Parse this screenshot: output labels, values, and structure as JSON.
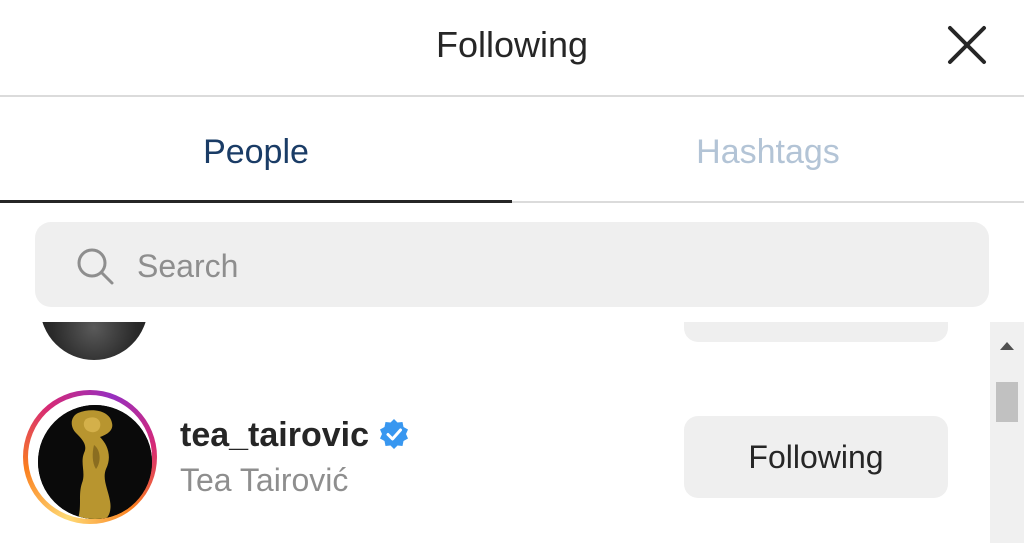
{
  "header": {
    "title": "Following",
    "close_icon": "close-icon"
  },
  "tabs": [
    {
      "label": "People",
      "active": true
    },
    {
      "label": "Hashtags",
      "active": false
    }
  ],
  "search": {
    "placeholder": "Search",
    "value": ""
  },
  "list": {
    "items": [
      {
        "username": "tea_tairovic",
        "full_name": "Tea Tairović",
        "verified": true,
        "button_label": "Following"
      }
    ]
  },
  "colors": {
    "active_tab": "#1a3c66",
    "inactive_tab": "#b3c4d6",
    "button_bg": "#efefef",
    "verified_badge": "#3897f0"
  }
}
